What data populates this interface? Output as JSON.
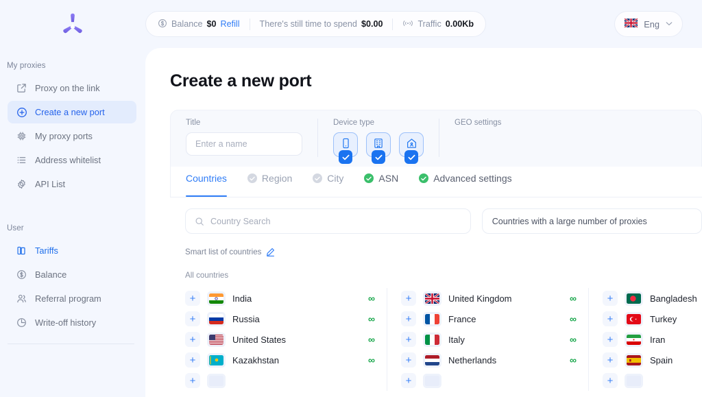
{
  "brand": {
    "logo_name": "triskelion-logo",
    "accent": "#7c6cf0"
  },
  "sidebar": {
    "groups": [
      {
        "title": "My proxies",
        "items": [
          {
            "label": "Proxy on the link",
            "icon": "external-link-icon",
            "active": false
          },
          {
            "label": "Create a new port",
            "icon": "plus-circle-icon",
            "active": true
          },
          {
            "label": "My proxy ports",
            "icon": "chip-icon",
            "active": false
          },
          {
            "label": "Address whitelist",
            "icon": "list-icon",
            "active": false
          },
          {
            "label": "API List",
            "icon": "gear-icon",
            "active": false
          }
        ]
      },
      {
        "title": "User",
        "items": [
          {
            "label": "Tariffs",
            "icon": "tariffs-icon",
            "active": false,
            "accent": true
          },
          {
            "label": "Balance",
            "icon": "dollar-circle-icon",
            "active": false
          },
          {
            "label": "Referral program",
            "icon": "users-icon",
            "active": false
          },
          {
            "label": "Write-off history",
            "icon": "pie-clock-icon",
            "active": false
          }
        ]
      }
    ]
  },
  "topbar": {
    "balance_label": "Balance",
    "balance_value": "$0",
    "refill_label": "Refill",
    "spend_label": "There's still time to spend",
    "spend_value": "$0.00",
    "traffic_label": "Traffic",
    "traffic_value": "0.00Kb",
    "language": "Eng",
    "language_flag": "uk-flag-icon",
    "chevron": "⌄"
  },
  "page": {
    "title": "Create a new port"
  },
  "config": {
    "title_label": "Title",
    "title_placeholder": "Enter a name",
    "title_value": "",
    "device_label": "Device type",
    "devices": [
      {
        "name": "mobile",
        "icon": "mobile-icon",
        "checked": true
      },
      {
        "name": "datacenter",
        "icon": "building-icon",
        "checked": true
      },
      {
        "name": "residential",
        "icon": "home-icon",
        "checked": true
      }
    ],
    "geo_label": "GEO settings"
  },
  "tabs": [
    {
      "label": "Countries",
      "state": "active",
      "marker": "none"
    },
    {
      "label": "Region",
      "state": "disabled",
      "marker": "grey"
    },
    {
      "label": "City",
      "state": "disabled",
      "marker": "grey"
    },
    {
      "label": "ASN",
      "state": "normal",
      "marker": "green"
    },
    {
      "label": "Advanced settings",
      "state": "normal",
      "marker": "green"
    }
  ],
  "search": {
    "placeholder": "Country Search",
    "value": "",
    "icon": "search-icon"
  },
  "filter": {
    "value": "Countries with a large number of proxies"
  },
  "smart_list": {
    "label": "Smart list of countries",
    "edit_icon": "pencil-icon"
  },
  "all_countries_label": "All countries",
  "countries": {
    "columns": [
      [
        {
          "name": "India",
          "flag": "in",
          "count": "∞",
          "add": "+"
        },
        {
          "name": "Russia",
          "flag": "ru",
          "count": "∞",
          "add": "+"
        },
        {
          "name": "United States",
          "flag": "us",
          "count": "∞",
          "add": "+"
        },
        {
          "name": "Kazakhstan",
          "flag": "kz",
          "count": "∞",
          "add": "+"
        },
        {
          "name": "",
          "flag": "partial-1",
          "count": "",
          "add": "+"
        }
      ],
      [
        {
          "name": "United Kingdom",
          "flag": "gb",
          "count": "∞",
          "add": "+"
        },
        {
          "name": "France",
          "flag": "fr",
          "count": "∞",
          "add": "+"
        },
        {
          "name": "Italy",
          "flag": "it",
          "count": "∞",
          "add": "+"
        },
        {
          "name": "Netherlands",
          "flag": "nl",
          "count": "∞",
          "add": "+"
        },
        {
          "name": "",
          "flag": "partial-2",
          "count": "",
          "add": "+"
        }
      ],
      [
        {
          "name": "Bangladesh",
          "flag": "bd",
          "count": "",
          "add": "+"
        },
        {
          "name": "Turkey",
          "flag": "tr",
          "count": "",
          "add": "+"
        },
        {
          "name": "Iran",
          "flag": "ir",
          "count": "",
          "add": "+"
        },
        {
          "name": "Spain",
          "flag": "es",
          "count": "",
          "add": "+"
        },
        {
          "name": "",
          "flag": "partial-3",
          "count": "",
          "add": "+"
        }
      ]
    ]
  }
}
